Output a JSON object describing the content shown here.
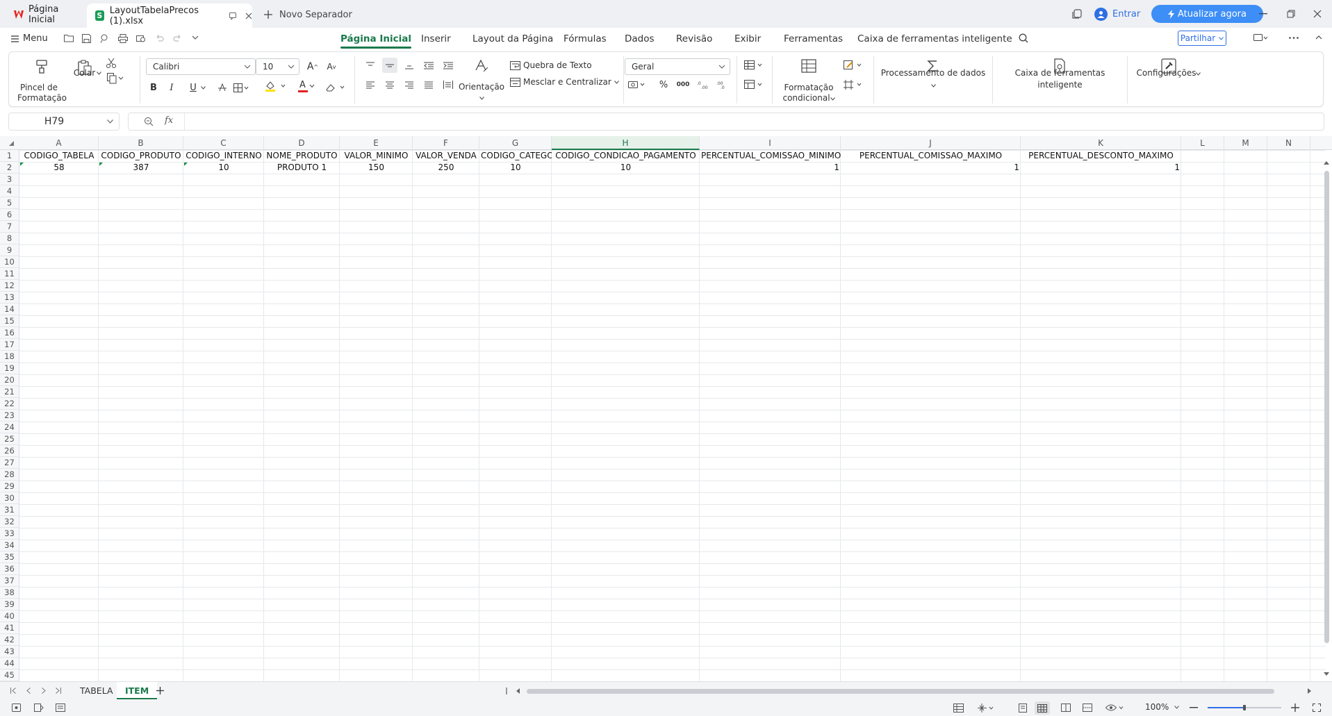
{
  "titlebar": {
    "home_tab": "Página Inicial",
    "file_tab": "LayoutTabelaPrecos (1).xlsx",
    "new_tab": "Novo Separador",
    "signin": "Entrar",
    "upgrade": "Atualizar agora"
  },
  "menubar": {
    "menu_label": "Menu",
    "tabs": [
      "Página Inicial",
      "Inserir",
      "Layout da Página",
      "Fórmulas",
      "Dados",
      "Revisão",
      "Exibir",
      "Ferramentas",
      "Caixa de ferramentas inteligente"
    ],
    "share": "Partilhar"
  },
  "ribbon": {
    "format_painter": "Pincel de Formatação",
    "paste": "Colar",
    "font_name": "Calibri",
    "font_size": "10",
    "wrap_text": "Quebra de Texto",
    "orientation": "Orientação",
    "merge_center": "Mesclar e Centralizar",
    "number_format": "Geral",
    "conditional_format": "Formatação condicional",
    "data_processing": "Processamento de dados",
    "smart_toolbox": "Caixa de ferramentas inteligente",
    "settings": "Configurações",
    "bold": "B",
    "italic": "I",
    "underline": "U",
    "grow_font": "A",
    "shrink_font": "A",
    "font_color": "A",
    "percent": "%",
    "thousands": "000"
  },
  "formula_bar": {
    "cell_ref": "H79",
    "fx": "fx",
    "value": ""
  },
  "sheet": {
    "columns": [
      "A",
      "B",
      "C",
      "D",
      "E",
      "F",
      "G",
      "H",
      "I",
      "J",
      "K",
      "L",
      "M",
      "N"
    ],
    "selected_column": "H",
    "rows": [
      "1",
      "2",
      "3",
      "4",
      "5",
      "6",
      "7",
      "8",
      "9",
      "10",
      "11",
      "12",
      "13",
      "14",
      "15",
      "16",
      "17",
      "18",
      "19",
      "20",
      "21",
      "22",
      "23",
      "24",
      "25",
      "26",
      "27",
      "28",
      "29",
      "30",
      "31",
      "32",
      "33",
      "34",
      "35",
      "36",
      "37",
      "38",
      "39",
      "40",
      "41",
      "42",
      "43",
      "44",
      "45"
    ],
    "header_row": [
      "CODIGO_TABELA",
      "CODIGO_PRODUTO",
      "CODIGO_INTERNO",
      "NOME_PRODUTO",
      "VALOR_MINIMO",
      "VALOR_VENDA",
      "CODIGO_CATEGORIA",
      "CODIGO_CONDICAO_PAGAMENTO",
      "PERCENTUAL_COMISSAO_MINIMO",
      "PERCENTUAL_COMISSAO_MAXIMO",
      "PERCENTUAL_DESCONTO_MAXIMO"
    ],
    "data_row": [
      "58",
      "387",
      "10",
      "PRODUTO 1",
      "150",
      "250",
      "10",
      "10",
      "1",
      "1",
      "1"
    ]
  },
  "sheet_tabs": [
    "TABELA",
    "ITEM"
  ],
  "active_sheet": "ITEM",
  "statusbar": {
    "zoom": "100%",
    "zoom_level": 0.5
  },
  "colors": {
    "accent": "#1a7a4c",
    "upgrade_button": "#3d8ef7",
    "share_border": "#2f6fe4",
    "font_color_bar": "#e02020",
    "highlight_bar": "#ffe000"
  }
}
